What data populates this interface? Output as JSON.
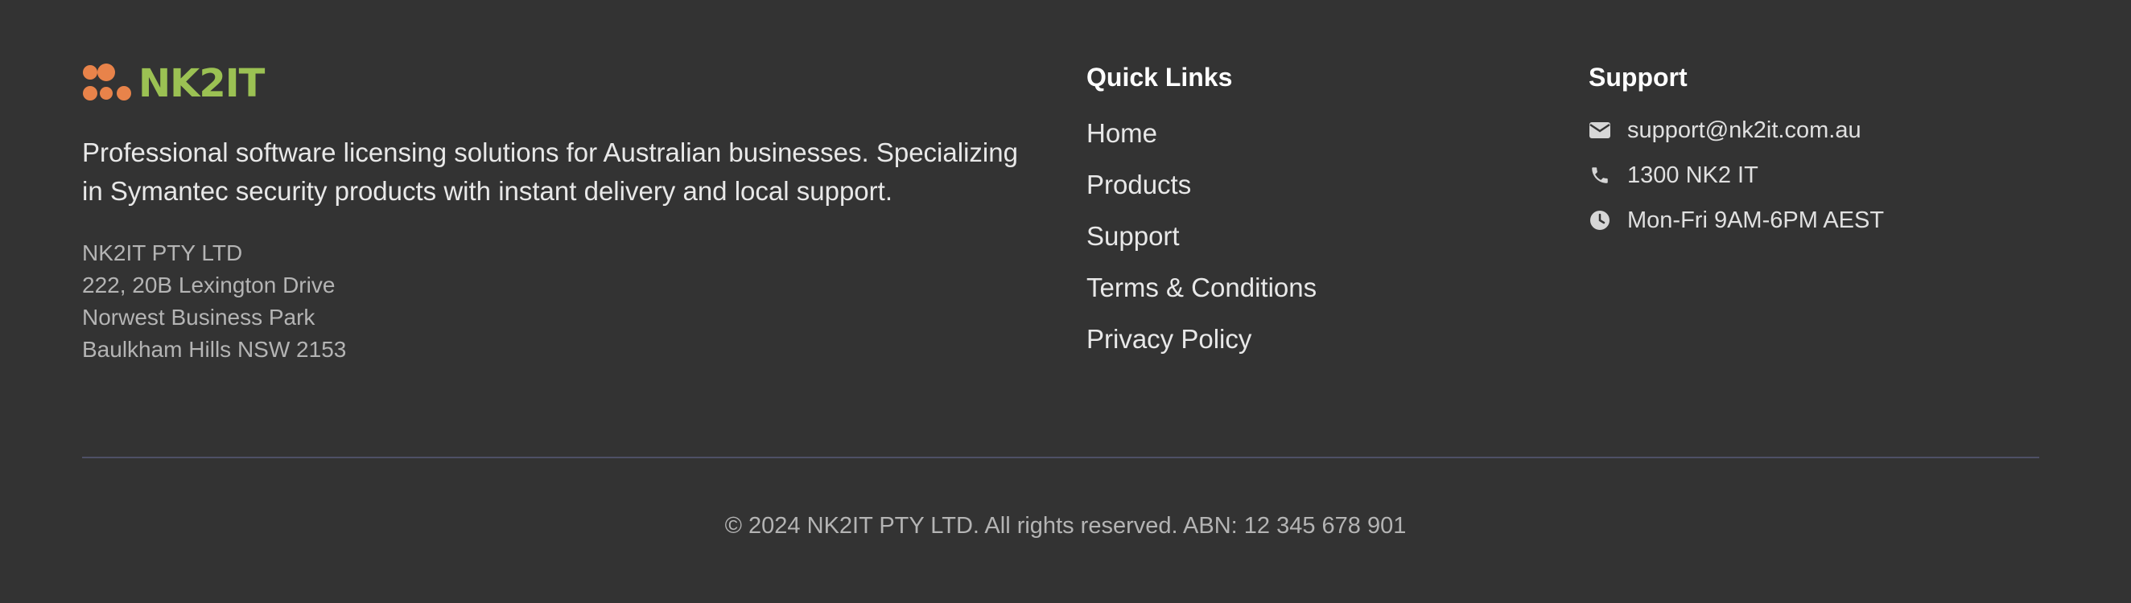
{
  "brand": {
    "name": "NK2IT",
    "logo_dot_color": "#e8834a",
    "logo_text_color": "#9bc153",
    "description": "Professional software licensing solutions for Australian businesses. Specializing in Symantec security products with instant delivery and local support.",
    "address": [
      "NK2IT PTY LTD",
      "222, 20B Lexington Drive",
      "Norwest Business Park",
      "Baulkham Hills NSW 2153"
    ]
  },
  "quick_links": {
    "title": "Quick Links",
    "items": [
      "Home",
      "Products",
      "Support",
      "Terms & Conditions",
      "Privacy Policy"
    ]
  },
  "support": {
    "title": "Support",
    "items": [
      {
        "icon": "mail-icon",
        "text": "support@nk2it.com.au"
      },
      {
        "icon": "phone-icon",
        "text": "1300 NK2 IT"
      },
      {
        "icon": "clock-icon",
        "text": "Mon-Fri 9AM-6PM AEST"
      }
    ]
  },
  "copyright": "© 2024 NK2IT PTY LTD. All rights reserved. ABN: 12 345 678 901"
}
